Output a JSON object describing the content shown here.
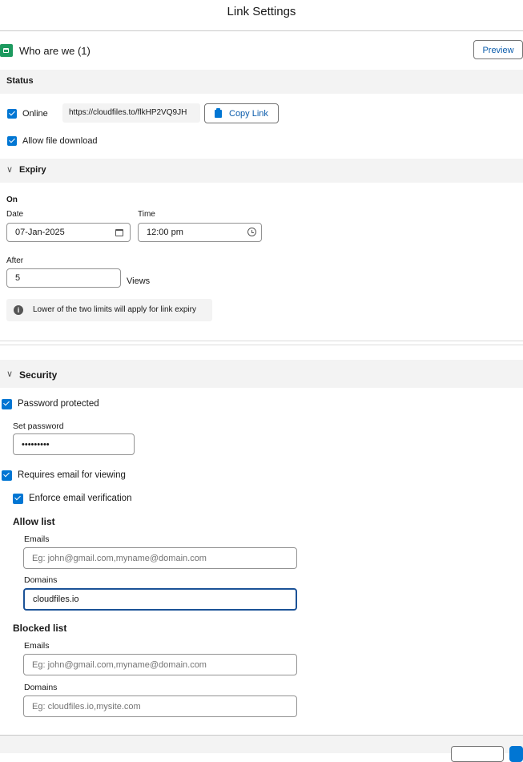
{
  "modal": {
    "title": "Link Settings"
  },
  "record": {
    "title": "Who are we (1)",
    "icon": "document-icon",
    "preview_label": "Preview"
  },
  "status": {
    "heading": "Status",
    "online_label": "Online",
    "online_checked": true,
    "link_url": "https://cloudfiles.to/flkHP2VQ9JH",
    "copy_link_label": "Copy Link",
    "allow_download_label": "Allow file download",
    "allow_download_checked": true
  },
  "expiry": {
    "heading": "Expiry",
    "on_label": "On",
    "date_label": "Date",
    "date_value": "07-Jan-2025",
    "time_label": "Time",
    "time_value": "12:00 pm",
    "after_label": "After",
    "views_value": "5",
    "views_unit": "Views",
    "info_text": "Lower of the two limits will apply for link expiry"
  },
  "security": {
    "heading": "Security",
    "password_protected_label": "Password protected",
    "password_protected_checked": true,
    "set_password_label": "Set password",
    "password_value": "•••••••••",
    "requires_email_label": "Requires email for viewing",
    "requires_email_checked": true,
    "enforce_verification_label": "Enforce email verification",
    "enforce_verification_checked": true,
    "allow_list": {
      "heading": "Allow list",
      "emails_label": "Emails",
      "emails_placeholder": "Eg: john@gmail.com,myname@domain.com",
      "emails_value": "",
      "domains_label": "Domains",
      "domains_value": "cloudfiles.io"
    },
    "blocked_list": {
      "heading": "Blocked list",
      "emails_label": "Emails",
      "emails_placeholder": "Eg: john@gmail.com,myname@domain.com",
      "domains_label": "Domains",
      "domains_placeholder": "Eg: cloudfiles.io,mysite.com"
    }
  },
  "colors": {
    "brand": "#0176d3",
    "button_text": "#0b5cab",
    "section_bg": "#f3f3f3",
    "record_icon": "#1d9a5f"
  }
}
